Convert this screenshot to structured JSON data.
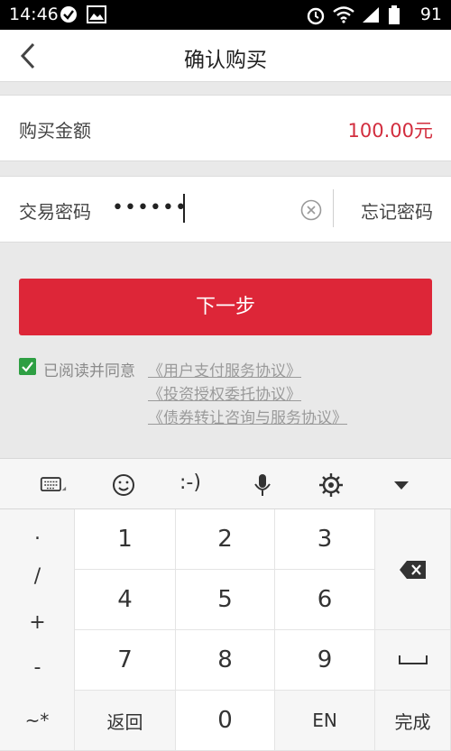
{
  "status": {
    "time": "14:46",
    "battery": "91"
  },
  "nav": {
    "title": "确认购买"
  },
  "amount": {
    "label": "购买金额",
    "value": "100.00元"
  },
  "password": {
    "label": "交易密码",
    "masked": "••••••",
    "forgot": "忘记密码"
  },
  "next_button": "下一步",
  "agreement": {
    "prefix": "已阅读并同意",
    "links": [
      "《用户支付服务协议》",
      "《投资授权委托协议》",
      "《债券转让咨询与服务协议》"
    ]
  },
  "keyboard": {
    "toolbar": [
      "keyboard-icon",
      "emoji-icon",
      "emoticon",
      "microphone-icon",
      "settings-icon",
      "collapse-icon"
    ],
    "emoticon_label": ":-)",
    "side_symbols": [
      ".",
      "/",
      "+",
      "-"
    ],
    "digits": [
      "1",
      "2",
      "3",
      "4",
      "5",
      "6",
      "7",
      "8",
      "9",
      "0"
    ],
    "bottom": {
      "symbols": "~*",
      "back": "返回",
      "lang": "EN",
      "done": "完成"
    }
  },
  "colors": {
    "accent": "#dd2638",
    "amount": "#d22d3e",
    "check": "#2e9f43"
  }
}
